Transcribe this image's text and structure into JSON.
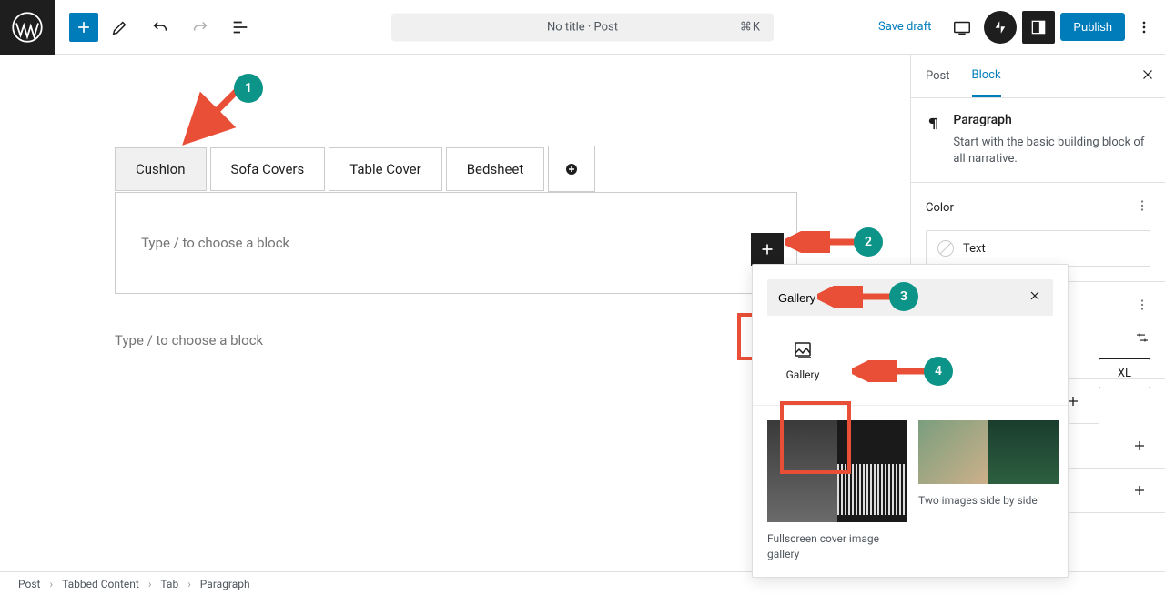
{
  "topbar": {
    "doc_title": "No title · Post",
    "kbd": "⌘K",
    "save_draft": "Save draft",
    "publish": "Publish"
  },
  "tabs": [
    "Cushion",
    "Sofa Covers",
    "Table Cover",
    "Bedsheet"
  ],
  "placeholder": "Type / to choose a block",
  "placeholder2": "Type / to choose a block",
  "sidebar": {
    "tabs": [
      "Post",
      "Block"
    ],
    "block_name": "Paragraph",
    "block_desc": "Start with the basic building block of all narrative.",
    "color_label": "Color",
    "text_label": "Text",
    "xl": "XL"
  },
  "inserter": {
    "search": "Gallery",
    "item": "Gallery",
    "pat1": "Fullscreen cover image gallery",
    "pat2": "Two images side by side"
  },
  "breadcrumb": [
    "Post",
    "Tabbed Content",
    "Tab",
    "Paragraph"
  ],
  "annotations": [
    "1",
    "2",
    "3",
    "4"
  ]
}
